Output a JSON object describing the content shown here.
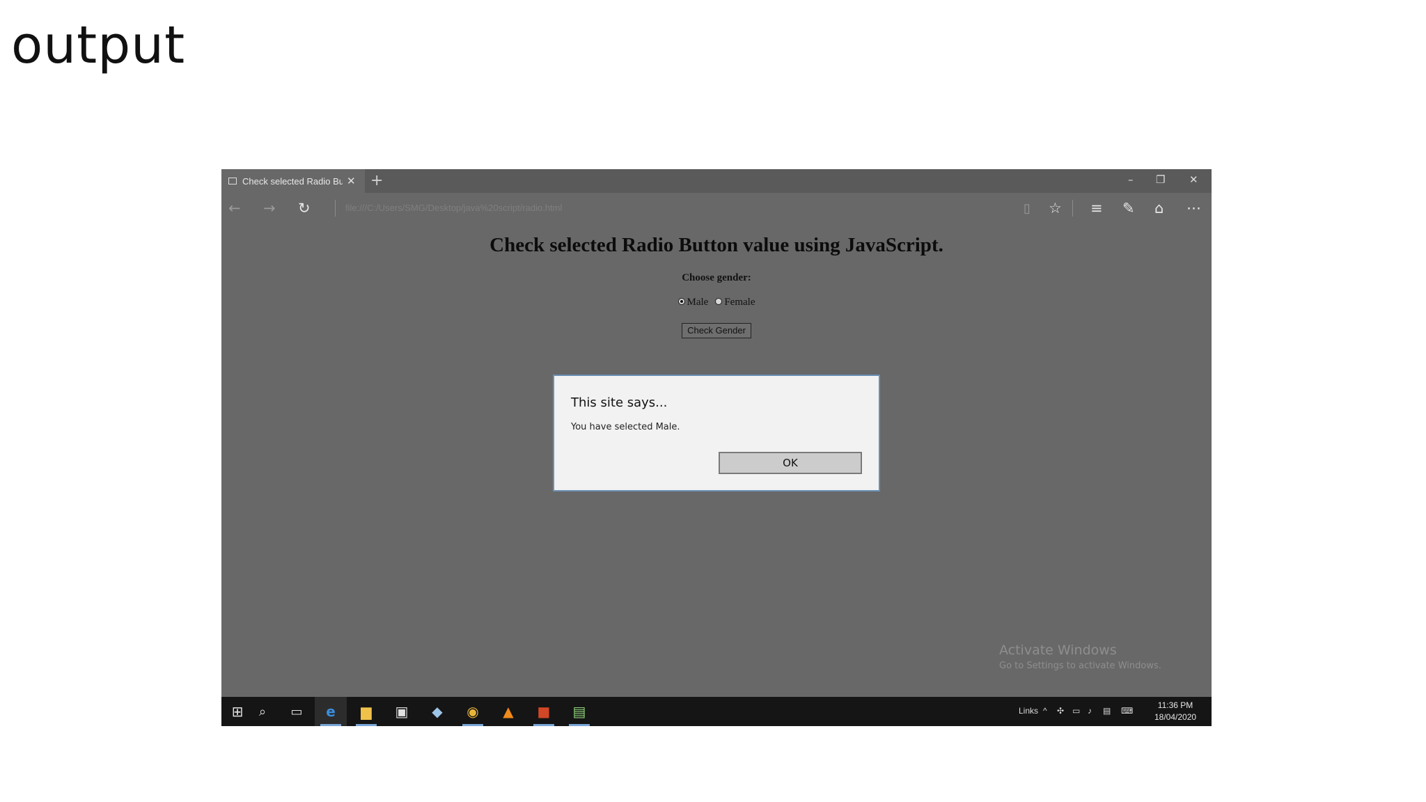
{
  "slide": {
    "title": "output"
  },
  "browser": {
    "tab_title": "Check selected Radio Bu",
    "url": "file:///C:/Users/SMG/Desktop/java%20script/radio.html"
  },
  "page": {
    "heading": "Check selected Radio Button value using JavaScript.",
    "choose_label": "Choose gender:",
    "radio_options": [
      {
        "label": "Male",
        "checked": true
      },
      {
        "label": "Female",
        "checked": false
      }
    ],
    "check_button": "Check Gender"
  },
  "dialog": {
    "title": "This site says...",
    "message": "You have selected Male.",
    "ok_label": "OK"
  },
  "watermark": {
    "line1": "Activate Windows",
    "line2": "Go to Settings to activate Windows."
  },
  "taskbar": {
    "links_label": "Links",
    "time": "11:36 PM",
    "date": "18/04/2020"
  }
}
